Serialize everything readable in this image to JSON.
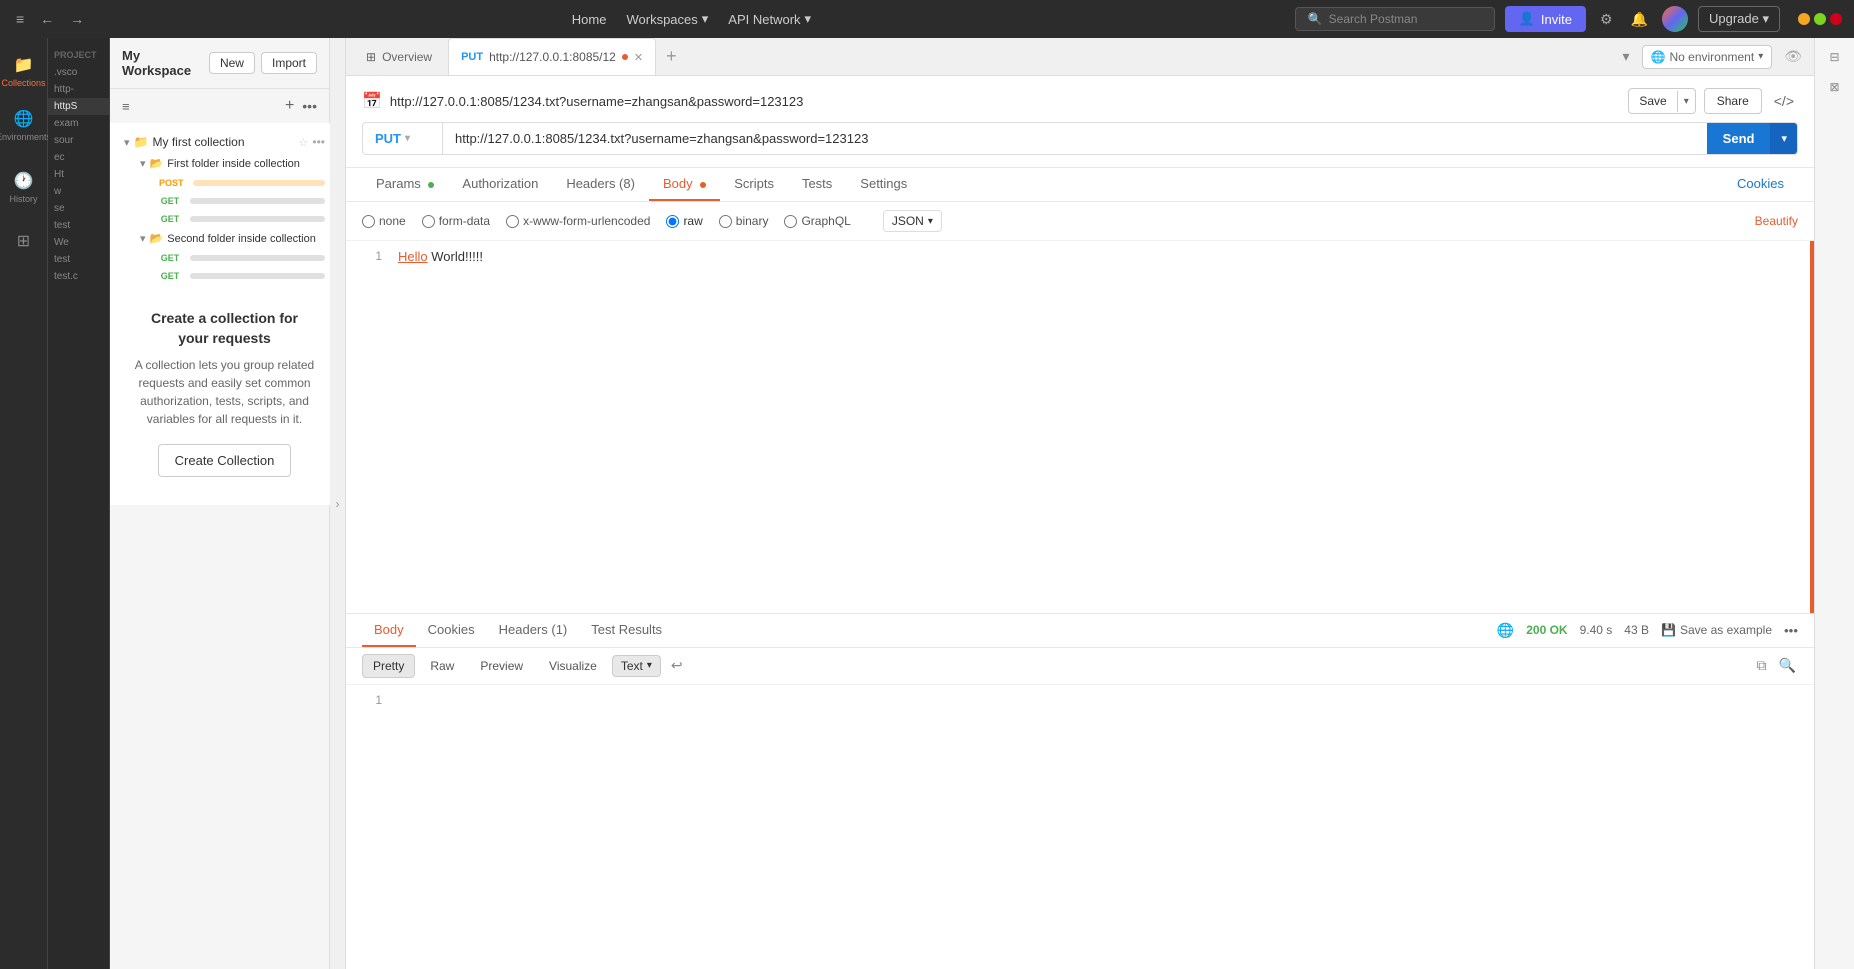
{
  "titlebar": {
    "home": "Home",
    "workspaces": "Workspaces",
    "api_network": "API Network",
    "search_placeholder": "Search Postman",
    "invite_label": "Invite",
    "upgrade_label": "Upgrade"
  },
  "sidebar": {
    "collections_label": "Collections",
    "history_label": "History",
    "workspace_label": "My Workspace",
    "new_label": "New",
    "import_label": "Import",
    "project_header": "PROJECT",
    "project_items": [
      ".vsco",
      "http-",
      "httpS",
      "exam",
      "sour",
      "ec",
      "Ht",
      "w"
    ]
  },
  "collection": {
    "name": "My first collection",
    "first_folder": "First folder inside collection",
    "second_folder": "Second folder inside collection",
    "methods": [
      "GET",
      "POST",
      "GET",
      "GET",
      "GET"
    ],
    "cta_title": "Create a collection for your requests",
    "cta_desc": "A collection lets you group related requests and easily set common authorization, tests, scripts, and variables for all requests in it.",
    "cta_button": "Create Collection"
  },
  "tabs": {
    "overview_label": "Overview",
    "active_tab_url": "PUT  http://127.0.0.1:8085/12",
    "add_tab": "+",
    "no_environment": "No environment"
  },
  "request": {
    "title_url": "http://127.0.0.1:8085/1234.txt?username=zhangsan&password=123123",
    "save_label": "Save",
    "share_label": "Share",
    "method": "PUT",
    "url": "http://127.0.0.1:8085/1234.txt?username=zhangsan&password=123123",
    "send_label": "Send"
  },
  "request_tabs": {
    "params": "Params",
    "authorization": "Authorization",
    "headers": "Headers (8)",
    "body": "Body",
    "scripts": "Scripts",
    "tests": "Tests",
    "settings": "Settings",
    "cookies": "Cookies"
  },
  "body_options": {
    "none": "none",
    "form_data": "form-data",
    "urlencoded": "x-www-form-urlencoded",
    "raw": "raw",
    "binary": "binary",
    "graphql": "GraphQL",
    "json_type": "JSON",
    "beautify": "Beautify"
  },
  "code_body": {
    "line1": "Hello World!!!!!",
    "line_num": "1"
  },
  "response": {
    "body_tab": "Body",
    "cookies_tab": "Cookies",
    "headers_tab": "Headers (1)",
    "test_results_tab": "Test Results",
    "status": "200 OK",
    "time": "9.40 s",
    "size": "43 B",
    "save_example": "Save as example",
    "pretty_tab": "Pretty",
    "raw_tab": "Raw",
    "preview_tab": "Preview",
    "visualize_tab": "Visualize",
    "text_selector": "Text",
    "line_num": "1"
  }
}
